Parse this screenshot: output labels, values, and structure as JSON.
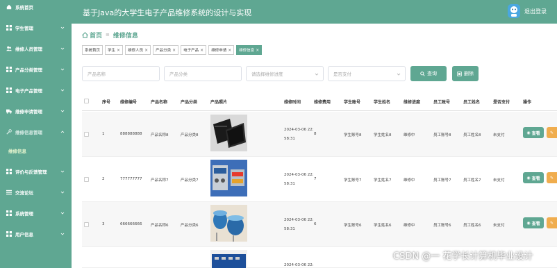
{
  "app": {
    "title": "基于Java的大学生电子产品维修系统的设计与实现",
    "logout": "退出登录"
  },
  "sidebar": {
    "items": [
      {
        "label": "系统首页"
      },
      {
        "label": "学生管理"
      },
      {
        "label": "维修人员管理"
      },
      {
        "label": "产品分类管理"
      },
      {
        "label": "电子产品管理"
      },
      {
        "label": "维修申请管理"
      },
      {
        "label": "维修信息管理"
      },
      {
        "label": "评价与反馈管理"
      },
      {
        "label": "交流论坛"
      },
      {
        "label": "系统管理"
      },
      {
        "label": "用户信息"
      }
    ],
    "sub_item": "维修信息"
  },
  "breadcrumb": {
    "home": "首页",
    "current": "维修信息"
  },
  "tags": [
    {
      "label": "系统首页"
    },
    {
      "label": "学生"
    },
    {
      "label": "维修人员"
    },
    {
      "label": "产品分类"
    },
    {
      "label": "电子产品"
    },
    {
      "label": "维修申请"
    },
    {
      "label": "维修信息"
    }
  ],
  "search": {
    "product_name_placeholder": "产品名称",
    "product_category_placeholder": "产品分类",
    "progress_placeholder": "请选择维修进度",
    "paid_placeholder": "是否支付",
    "search_label": "查询",
    "delete_label": "删除"
  },
  "table": {
    "headers": {
      "index": "序号",
      "repair_no": "维修编号",
      "product_name": "产品名称",
      "product_category": "产品分类",
      "product_photo": "产品照片",
      "repair_time": "维修时间",
      "repair_fee": "维修费用",
      "student_account": "学生账号",
      "student_name": "学生姓名",
      "progress": "维修进度",
      "staff_account": "员工账号",
      "staff_name": "员工姓名",
      "paid": "是否支付",
      "actions": "操作"
    },
    "view_label": "查看",
    "rows": [
      {
        "index": "1",
        "repair_no": "888888888",
        "product_name": "产品名称8",
        "product_category": "产品分类8",
        "time_line1": "2024-03-06 22:",
        "time_line2": "58:31",
        "fee": "8",
        "student_account": "学生账号8",
        "student_name": "学生姓名8",
        "progress": "维修中",
        "staff_account": "员工账号8",
        "staff_name": "员工姓名8",
        "paid": "未支付"
      },
      {
        "index": "2",
        "repair_no": "777777777",
        "product_name": "产品名称7",
        "product_category": "产品分类7",
        "time_line1": "2024-03-06 22:",
        "time_line2": "58:31",
        "fee": "7",
        "student_account": "学生账号7",
        "student_name": "学生姓名7",
        "progress": "维修中",
        "staff_account": "员工账号7",
        "staff_name": "员工姓名7",
        "paid": "未支付"
      },
      {
        "index": "3",
        "repair_no": "666666666",
        "product_name": "产品名称6",
        "product_category": "产品分类6",
        "time_line1": "2024-03-06 22:",
        "time_line2": "58:31",
        "fee": "6",
        "student_account": "学生账号6",
        "student_name": "学生姓名6",
        "progress": "维修中",
        "staff_account": "员工账号6",
        "staff_name": "员工姓名6",
        "paid": "未支付"
      },
      {
        "index": "",
        "repair_no": "",
        "product_name": "",
        "product_category": "",
        "time_line1": "2024-03-06 22:",
        "time_line2": "",
        "fee": "",
        "student_account": "",
        "student_name": "",
        "progress": "",
        "staff_account": "",
        "staff_name": "",
        "paid": ""
      }
    ]
  },
  "watermark": "CSDN @一 花学长计算机毕业设计",
  "colors": {
    "brand": "#5fa792",
    "edit": "#f0ad4e"
  }
}
